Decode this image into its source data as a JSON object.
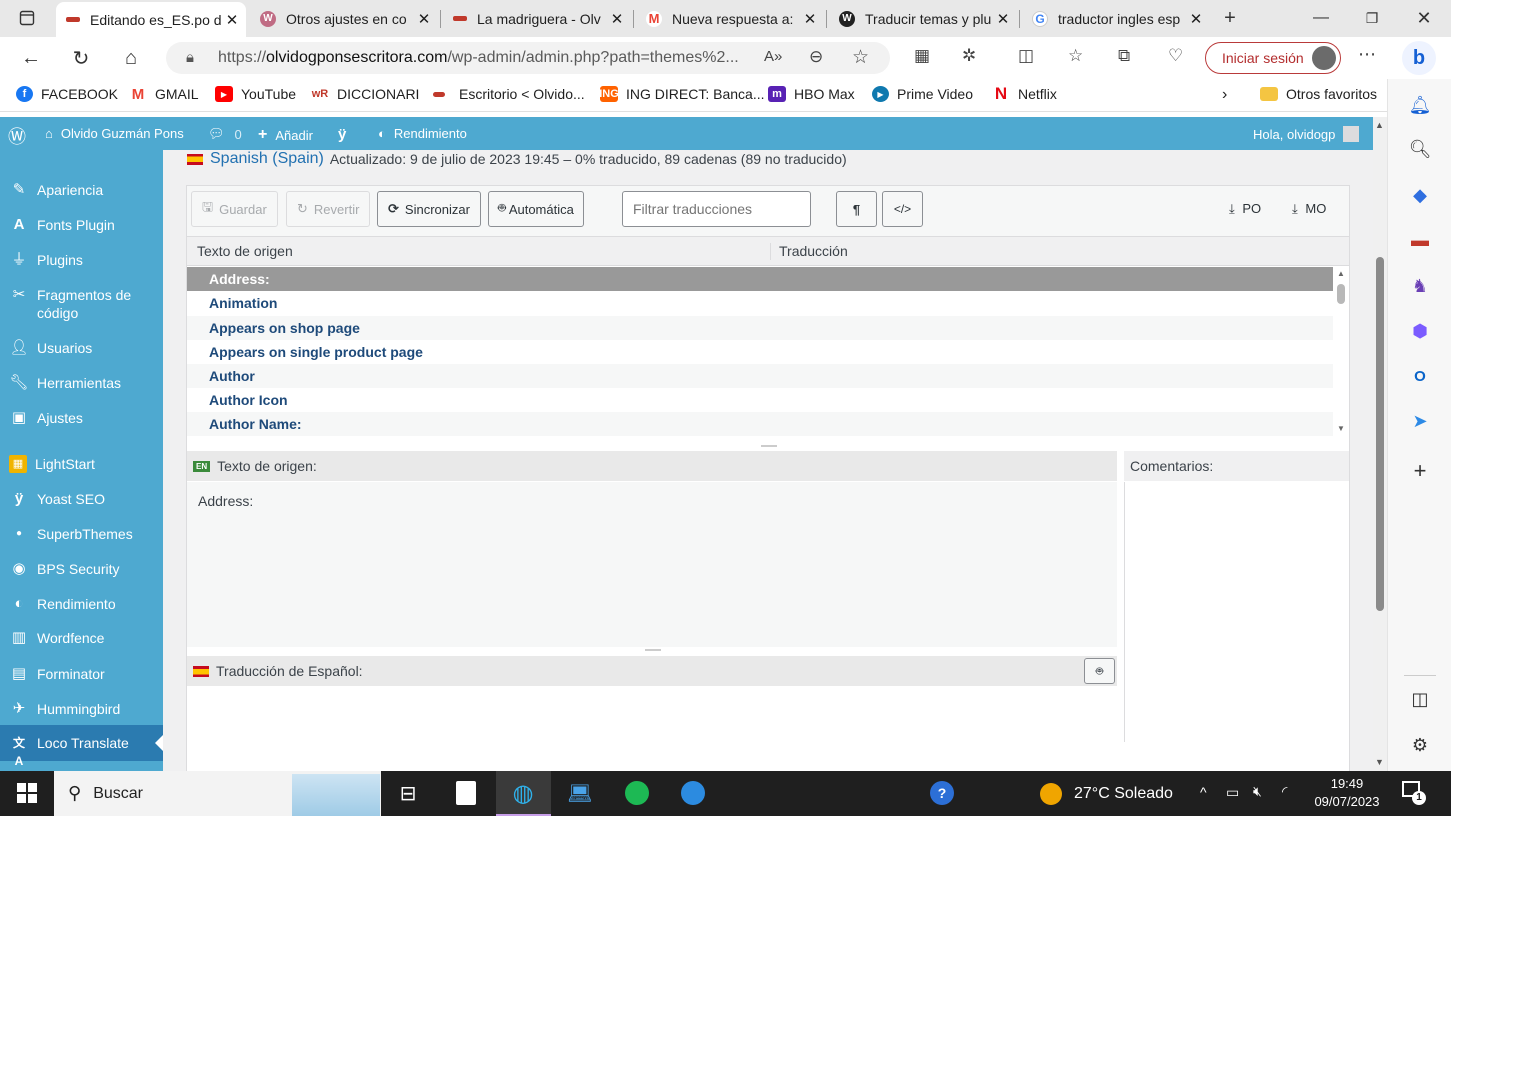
{
  "browser": {
    "tabs": [
      {
        "title": "Editando es_ES.po d",
        "active": true
      },
      {
        "title": "Otros ajustes en co",
        "active": false
      },
      {
        "title": "La madriguera - Olv",
        "active": false
      },
      {
        "title": "Nueva respuesta a: ",
        "active": false
      },
      {
        "title": "Traducir temas y plu",
        "active": false
      },
      {
        "title": "traductor ingles esp",
        "active": false
      }
    ],
    "new_tab_label": "+",
    "url_prefix": "https://",
    "url_domain": "olvidogponsescritora.com",
    "url_path": "/wp-admin/admin.php?path=themes%2...",
    "signin_label": "Iniciar sesión",
    "bookmarks": [
      {
        "label": "FACEBOOK",
        "color": "#1877f2"
      },
      {
        "label": "GMAIL",
        "color": "#ea4335"
      },
      {
        "label": "YouTube",
        "color": "#ff0000"
      },
      {
        "label": "DICCIONARI",
        "color": "#c0392b"
      },
      {
        "label": "Escritorio < Olvido...",
        "color": "#c0392b"
      },
      {
        "label": "ING DIRECT: Banca...",
        "color": "#ff6200"
      },
      {
        "label": "HBO Max",
        "color": "#5822b4"
      },
      {
        "label": "Prime Video",
        "color": "#0f79af"
      },
      {
        "label": "Netflix",
        "color": "#e50914"
      }
    ],
    "other_favorites_label": "Otros favoritos"
  },
  "wp_adminbar": {
    "site_name": "Olvido Guzmán Pons",
    "comments_count": "0",
    "add_label": "Añadir",
    "performance_label": "Rendimiento",
    "greeting": "Hola, olvidogp"
  },
  "sidemenu": {
    "items": [
      {
        "label": "Apariencia",
        "icon": "paintbrush-icon"
      },
      {
        "label": "Fonts Plugin",
        "icon": "font-icon"
      },
      {
        "label": "Plugins",
        "icon": "plugin-icon"
      },
      {
        "label": "Fragmentos de código",
        "icon": "scissors-icon"
      },
      {
        "label": "Usuarios",
        "icon": "user-icon"
      },
      {
        "label": "Herramientas",
        "icon": "wrench-icon"
      },
      {
        "label": "Ajustes",
        "icon": "settings-icon"
      },
      {
        "label": "LightStart",
        "icon": "lightstart-icon"
      },
      {
        "label": "Yoast SEO",
        "icon": "yoast-icon"
      },
      {
        "label": "SuperbThemes",
        "icon": "superb-icon"
      },
      {
        "label": "BPS Security",
        "icon": "shield-icon"
      },
      {
        "label": "Rendimiento",
        "icon": "performance-icon"
      },
      {
        "label": "Wordfence",
        "icon": "wordfence-icon"
      },
      {
        "label": "Forminator",
        "icon": "form-icon"
      },
      {
        "label": "Hummingbird",
        "icon": "hummingbird-icon"
      },
      {
        "label": "Loco Translate",
        "icon": "translate-icon",
        "current": true
      }
    ]
  },
  "editor": {
    "language": "Spanish (Spain)",
    "status": "Actualizado: 9 de julio de 2023 19:45 – 0% traducido, 89 cadenas (89 no traducido)",
    "toolbar": {
      "save": "Guardar",
      "revert": "Revertir",
      "sync": "Sincronizar",
      "auto": "Automática",
      "filter_placeholder": "Filtrar traducciones",
      "po": "PO",
      "mo": "MO"
    },
    "col_source": "Texto de origen",
    "col_translation": "Traducción",
    "rows": [
      "Address:",
      "Animation",
      "Appears on shop page",
      "Appears on single product page",
      "Author",
      "Author Icon",
      "Author Name:"
    ],
    "selected_row": 0,
    "source_label": "Texto de origen:",
    "source_lang_badge": "EN",
    "source_value": "Address:",
    "comments_label": "Comentarios:",
    "translation_label": "Traducción de Español:"
  },
  "taskbar": {
    "search_label": "Buscar",
    "weather": "27°C  Soleado",
    "time": "19:49",
    "date": "09/07/2023",
    "notifications": "1"
  },
  "colors": {
    "wp_blue": "#4ea9d0",
    "wp_current": "#2b7bb0",
    "link_blue": "#2271b1"
  }
}
